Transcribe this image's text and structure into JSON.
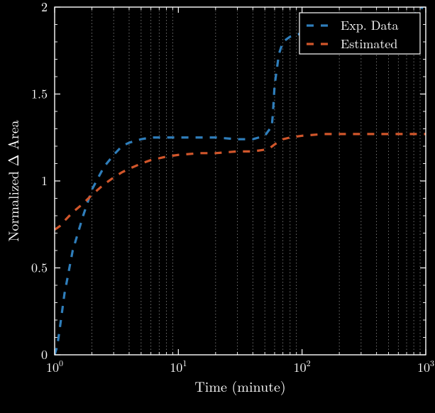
{
  "chart_data": {
    "type": "line",
    "xscale": "log",
    "xlim": [
      1,
      1000
    ],
    "ylim": [
      0,
      2
    ],
    "x_tick_values": [
      1,
      10,
      100,
      1000
    ],
    "x_tick_labels": [
      "10^0",
      "10^1",
      "10^2",
      "10^3"
    ],
    "y_tick_values": [
      0,
      0.5,
      1,
      1.5,
      2
    ],
    "y_tick_labels": [
      "0",
      "0.5",
      "1",
      "1.5",
      "2"
    ],
    "xlabel": "Time (minute)",
    "ylabel": "Normalized Δ Area",
    "grid_minor_x": true,
    "series": [
      {
        "name": "Exp. Data",
        "color": "#2f7ebb",
        "dash": "10,10",
        "x": [
          1.0,
          1.05,
          1.1,
          1.2,
          1.4,
          1.7,
          2.0,
          2.5,
          3.0,
          3.5,
          4.0,
          5.0,
          6.0,
          8.0,
          10.0,
          15.0,
          20.0,
          30.0,
          40.0,
          50.0,
          55.0,
          56.0,
          57.0,
          58.0,
          60.0,
          65.0,
          70.0,
          80.0,
          100,
          150,
          200,
          300,
          400,
          500,
          600,
          700,
          800,
          900,
          1000
        ],
        "y": [
          0.0,
          0.05,
          0.15,
          0.35,
          0.6,
          0.8,
          0.95,
          1.08,
          1.15,
          1.2,
          1.22,
          1.24,
          1.25,
          1.25,
          1.25,
          1.25,
          1.25,
          1.24,
          1.24,
          1.26,
          1.3,
          1.32,
          1.32,
          1.38,
          1.55,
          1.73,
          1.8,
          1.83,
          1.85,
          1.86,
          1.87,
          1.88,
          1.9,
          1.92,
          1.93,
          1.95,
          1.96,
          1.98,
          2.03
        ]
      },
      {
        "name": "Estimated",
        "color": "#d1562b",
        "dash": "10,10",
        "x": [
          1.0,
          1.05,
          1.1,
          1.2,
          1.4,
          1.7,
          2.0,
          2.5,
          3.0,
          3.5,
          4.0,
          5.0,
          6.0,
          8.0,
          10.0,
          15.0,
          20.0,
          30.0,
          40.0,
          50.0,
          55.0,
          60.0,
          70.0,
          80.0,
          100,
          150,
          200,
          300,
          500,
          1000
        ],
        "y": [
          0.72,
          0.73,
          0.74,
          0.77,
          0.82,
          0.87,
          0.92,
          0.98,
          1.02,
          1.05,
          1.07,
          1.1,
          1.12,
          1.14,
          1.15,
          1.16,
          1.16,
          1.17,
          1.17,
          1.18,
          1.19,
          1.21,
          1.24,
          1.25,
          1.26,
          1.27,
          1.27,
          1.27,
          1.27,
          1.27
        ]
      }
    ],
    "legend": {
      "position": "upper-right",
      "entries": [
        "Exp. Data",
        "Estimated"
      ]
    }
  }
}
